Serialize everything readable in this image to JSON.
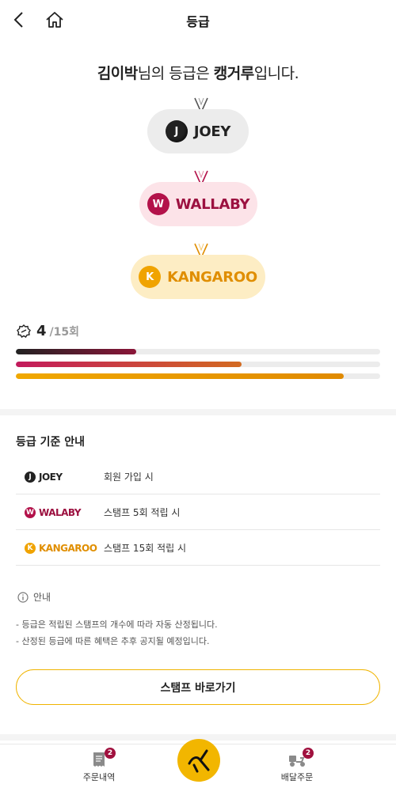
{
  "header": {
    "title": "등급"
  },
  "headline": {
    "name": "김이박",
    "middle": "님의 등급은 ",
    "grade": "캥거루",
    "suffix": "입니다."
  },
  "grades": {
    "joey": {
      "initial": "J",
      "label": "JOEY"
    },
    "wallaby": {
      "initial": "W",
      "label": "WALLABY"
    },
    "kangaroo": {
      "initial": "K",
      "label": "KANGAROO"
    }
  },
  "stamps": {
    "count": "4",
    "total": "/15회"
  },
  "progress": {
    "joey": 0.33,
    "wallaby": 0.62,
    "kangaroo": 0.9
  },
  "criteria": {
    "title": "등급 기준 안내",
    "rows": [
      {
        "initial": "J",
        "label": "JOEY",
        "desc": "회원 가입 시"
      },
      {
        "initial": "W",
        "label": "WALABY",
        "desc": "스탬프 5회 적립 시"
      },
      {
        "initial": "K",
        "label": "KANGAROO",
        "desc": "스탬프 15회 적립 시"
      }
    ]
  },
  "notice": {
    "title": "안내",
    "lines": [
      "-  등급은 적립된 스탬프의 개수에 따라 자동 산정됩니다.",
      "-  산정된 등급에 따른 혜택은 추후 공지될 예정입니다."
    ]
  },
  "button": {
    "label": "스탬프 바로가기"
  },
  "nav": {
    "orders": {
      "label": "주문내역",
      "badge": "2"
    },
    "delivery": {
      "label": "배달주문",
      "badge": "2"
    }
  },
  "colors": {
    "accent": "#f2b600",
    "wallaby": "#b3124a",
    "kangaroo": "#f0a300",
    "joey": "#222222"
  }
}
